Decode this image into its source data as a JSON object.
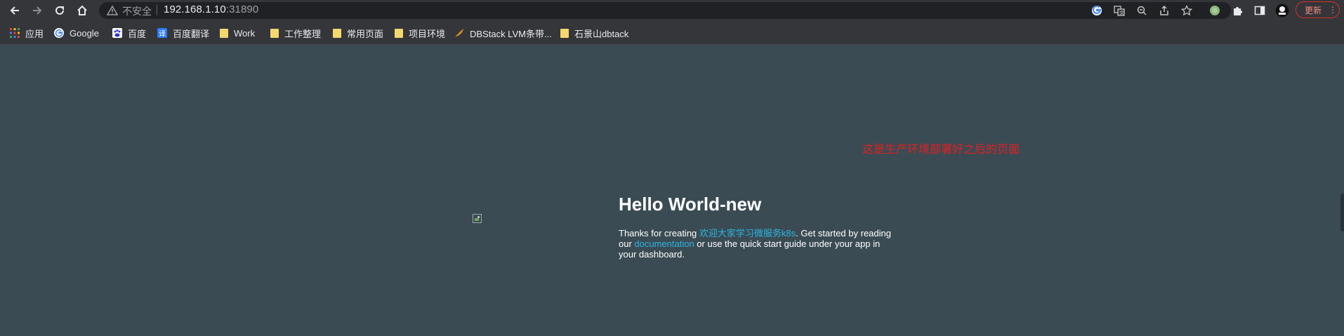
{
  "browser": {
    "security_label": "不安全",
    "url_host": "192.168.1.10",
    "url_port": ":31890",
    "update_label": "更新"
  },
  "bookmarks": [
    {
      "label": "应用",
      "icon": "apps-grid-icon"
    },
    {
      "label": "Google",
      "icon": "google-icon"
    },
    {
      "label": "百度",
      "icon": "baidu-icon"
    },
    {
      "label": "百度翻译",
      "icon": "baidu-translate-icon"
    },
    {
      "label": "Work",
      "icon": "folder-icon"
    },
    {
      "label": "工作整理",
      "icon": "folder-icon"
    },
    {
      "label": "常用页面",
      "icon": "folder-icon"
    },
    {
      "label": "项目环境",
      "icon": "folder-icon"
    },
    {
      "label": "DBStack LVM条带...",
      "icon": "dbstack-icon"
    },
    {
      "label": "石景山dbtack",
      "icon": "folder-icon"
    }
  ],
  "page": {
    "note": "这是生产环境部署好之后的页面",
    "title": "Hello World-new",
    "p1": "Thanks for creating ",
    "link1": "欢迎大家学习微服务k8s",
    "p2": ". Get started by reading our ",
    "link2": "documentation",
    "p3": " or use the quick start guide under your app in your dashboard."
  },
  "colors": {
    "page_background": "#3b4b54",
    "link": "#2bb5e0",
    "note": "#e02020"
  }
}
